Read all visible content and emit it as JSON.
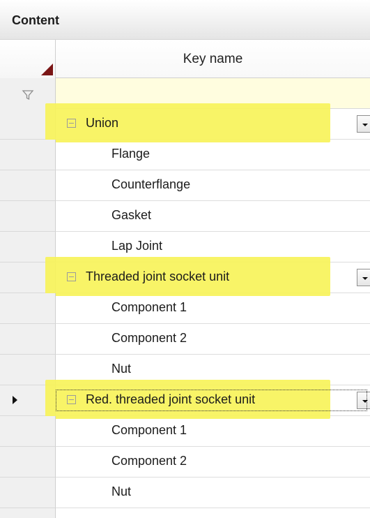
{
  "panel": {
    "title": "Content"
  },
  "grid": {
    "column_header": "Key name",
    "filter_value": "",
    "rows": [
      {
        "type": "group",
        "label": "Union",
        "highlighted": true,
        "current": false,
        "has_dropdown": true
      },
      {
        "type": "child",
        "label": "Flange"
      },
      {
        "type": "child",
        "label": "Counterflange"
      },
      {
        "type": "child",
        "label": "Gasket"
      },
      {
        "type": "child",
        "label": "Lap Joint"
      },
      {
        "type": "group",
        "label": "Threaded joint socket unit",
        "highlighted": true,
        "current": false,
        "has_dropdown": true
      },
      {
        "type": "child",
        "label": "Component 1"
      },
      {
        "type": "child",
        "label": "Component 2"
      },
      {
        "type": "child",
        "label": "Nut"
      },
      {
        "type": "group",
        "label": "Red. threaded joint socket unit",
        "highlighted": true,
        "current": true,
        "has_dropdown": true
      },
      {
        "type": "child",
        "label": "Component 1"
      },
      {
        "type": "child",
        "label": "Component 2"
      },
      {
        "type": "child",
        "label": "Nut"
      }
    ]
  },
  "icons": {
    "sort_indicator": "sort-indicator-icon",
    "filter": "filter-icon",
    "collapse": "collapse-icon",
    "dropdown": "chevron-down-icon",
    "current_row": "current-row-icon"
  },
  "colors": {
    "highlight": "#f7f35a",
    "filter_row_background": "#fffddf",
    "header_marker": "#7a1515"
  }
}
